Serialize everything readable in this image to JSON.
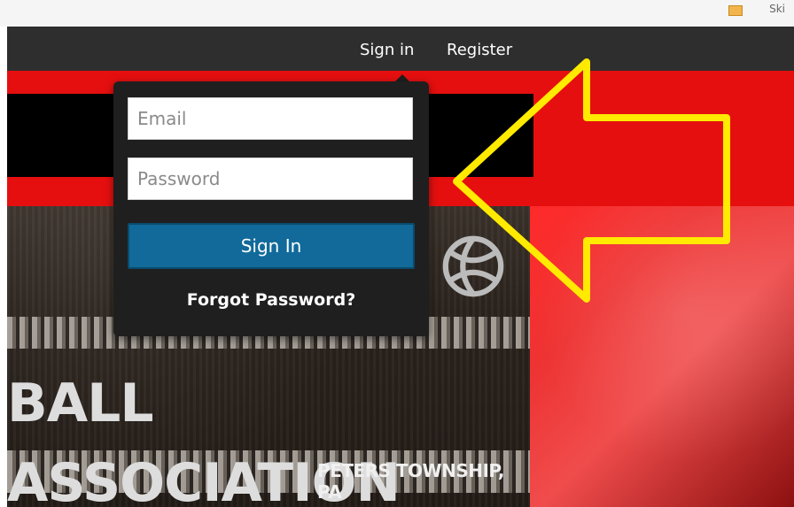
{
  "topbar": {
    "corner_text": "Ski"
  },
  "navbar": {
    "signin": "Sign in",
    "register": "Register"
  },
  "login": {
    "email_placeholder": "Email",
    "password_placeholder": "Password",
    "signin_button": "Sign In",
    "forgot_link": "Forgot Password?"
  },
  "hero": {
    "title_main": "BALL ASSOCIATION",
    "title_sub": "PETERS TOWNSHIP, PA"
  },
  "colors": {
    "nav_bg": "#2e2e2e",
    "brand_red": "#e60f0f",
    "popover_bg": "#1f1f1f",
    "signin_button": "#116a9a",
    "annotation_arrow": "#ffea00"
  },
  "icons": [
    "basketball-icon",
    "annotation-arrow-icon",
    "bookmark-icon"
  ]
}
